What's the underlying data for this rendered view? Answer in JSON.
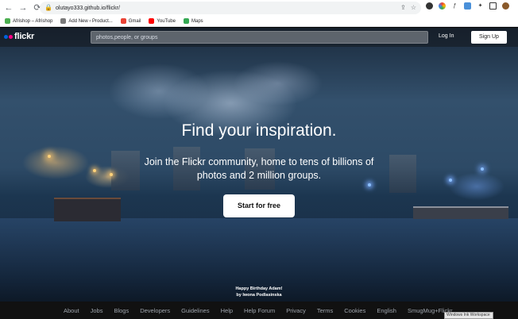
{
  "browser": {
    "url": "olutayo333.github.io/flickr/",
    "bookmarks": [
      {
        "label": "Afrishop – Afrishop",
        "color": "#4caf50"
      },
      {
        "label": "Add New ‹ Product...",
        "color": "#7a7a7a"
      },
      {
        "label": "Gmail",
        "color": "#ea4335"
      },
      {
        "label": "YouTube",
        "color": "#ff0000"
      },
      {
        "label": "Maps",
        "color": "#34a853"
      }
    ]
  },
  "header": {
    "logo_text": "flickr",
    "search_placeholder": "photos,people, or groups",
    "login_label": "Log In",
    "signup_label": "Sign Up"
  },
  "hero": {
    "title": "Find your inspiration.",
    "subtitle": "Join the Flickr community, home to tens of billions of photos and 2 million groups.",
    "cta_label": "Start for free"
  },
  "credit": {
    "line1": "Happy Birthday Adam!",
    "line2": "by Iwona Podlasinska"
  },
  "footer": {
    "links": [
      "About",
      "Jobs",
      "Blogs",
      "Developers",
      "Guidelines",
      "Help",
      "Help Forum",
      "Privacy",
      "Terms",
      "Cookies",
      "English",
      "SmugMug+Flickr"
    ]
  },
  "overlay": {
    "watermark": "Windows Ink Workspace"
  },
  "colors": {
    "flickr_blue": "#0063dc",
    "flickr_pink": "#ff0084"
  }
}
